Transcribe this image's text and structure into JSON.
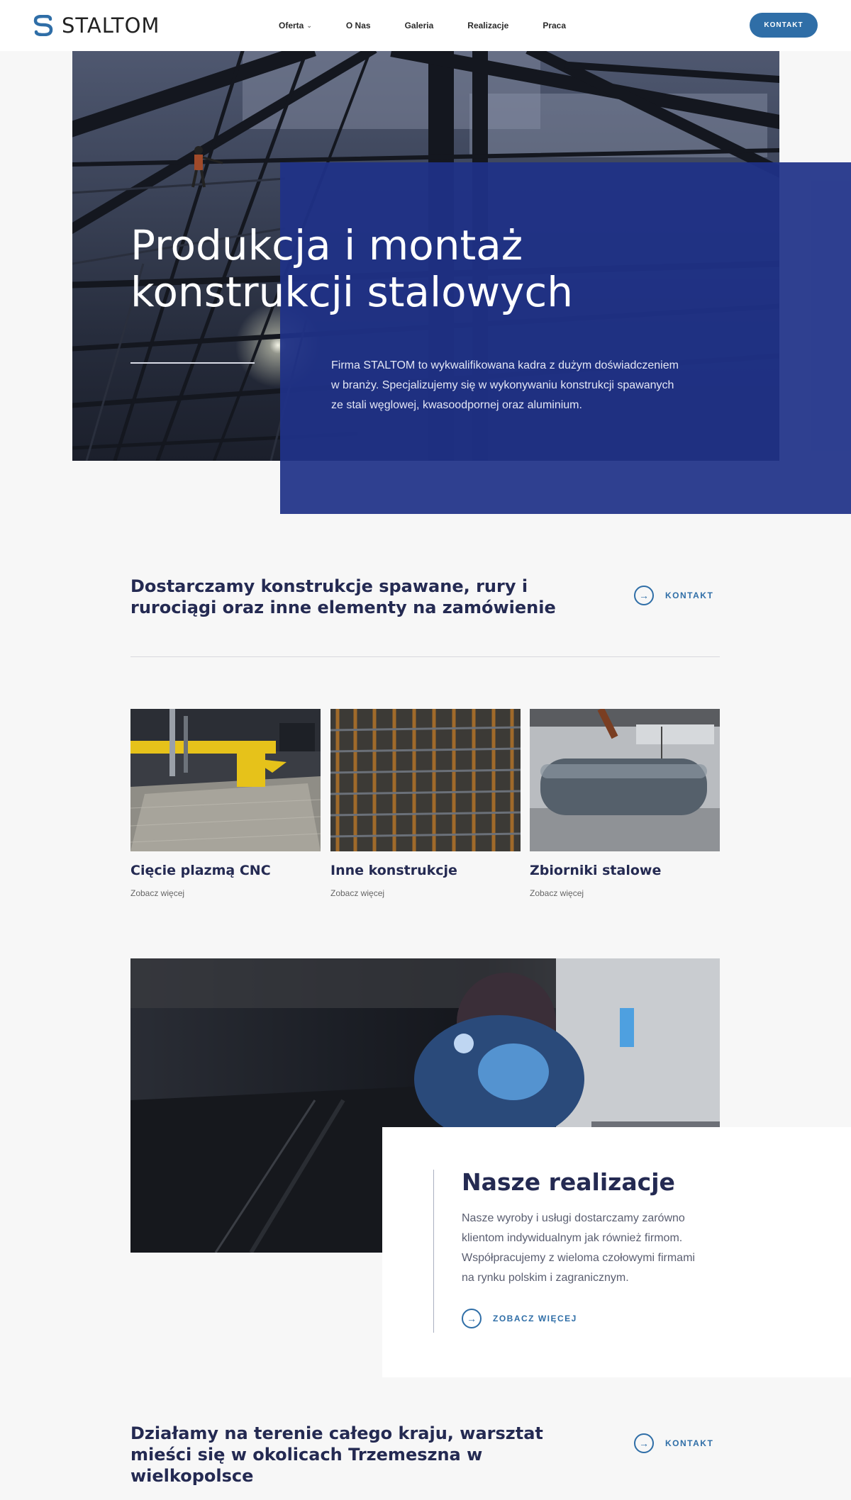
{
  "header": {
    "logo_text": "STALTOM",
    "nav": [
      {
        "label": "Oferta",
        "has_dropdown": true
      },
      {
        "label": "O Nas",
        "has_dropdown": false
      },
      {
        "label": "Galeria",
        "has_dropdown": false
      },
      {
        "label": "Realizacje",
        "has_dropdown": false
      },
      {
        "label": "Praca",
        "has_dropdown": false
      }
    ],
    "cta_label": "KONTAKT"
  },
  "hero": {
    "title_line1": "Produkcja i montaż",
    "title_line2": "konstrukcji stalowych",
    "description": "Firma STALTOM to wykwalifikowana kadra z dużym doświadczeniem w branży. Specjalizujemy się w wykonywaniu konstrukcji spawanych ze stali węglowej, kwasoodpornej oraz aluminium."
  },
  "section_intro": {
    "title": "Dostarczamy konstrukcje spawane, rury i rurociągi oraz inne elementy na zamówienie",
    "link_label": "KONTAKT"
  },
  "offers": [
    {
      "title": "Cięcie plazmą CNC",
      "more": "Zobacz więcej"
    },
    {
      "title": "Inne konstrukcje",
      "more": "Zobacz więcej"
    },
    {
      "title": "Zbiorniki stalowe",
      "more": "Zobacz więcej"
    }
  ],
  "realizacje": {
    "title": "Nasze realizacje",
    "text": "Nasze wyroby i usługi dostarczamy zarówno klientom indywidualnym jak również firmom. Współpracujemy z wieloma czołowymi firmami na rynku polskim i zagranicznym.",
    "link_label": "ZOBACZ WIĘCEJ"
  },
  "section_bottom": {
    "title": "Działamy na terenie całego kraju, warsztat mieści się w okolicach Trzemeszna w wielkopolsce",
    "link_label": "KONTAKT"
  },
  "colors": {
    "accent": "#2f6ea7",
    "hero_overlay": "#1f3188",
    "heading": "#242a52"
  }
}
